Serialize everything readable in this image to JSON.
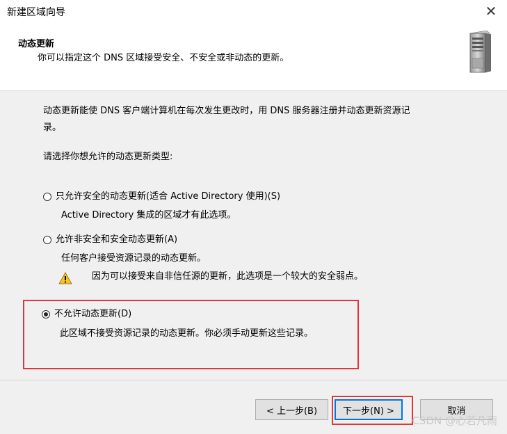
{
  "window": {
    "title": "新建区域向导",
    "close_glyph": "✕"
  },
  "header": {
    "title": "动态更新",
    "subtitle": "你可以指定这个 DNS 区域接受安全、不安全或非动态的更新。",
    "icon": "server-icon"
  },
  "body": {
    "intro_line1": "动态更新能使 DNS 客户端计算机在每次发生更改时，用 DNS 服务器注册并动态更新资源记",
    "intro_line2": "录。",
    "prompt": "请选择你想允许的动态更新类型:",
    "options": [
      {
        "label": "只允许安全的动态更新(适合 Active Directory 使用)(S)",
        "description": "Active Directory 集成的区域才有此选项。",
        "selected": false
      },
      {
        "label": "允许非安全和安全动态更新(A)",
        "description": "任何客户接受资源记录的动态更新。",
        "warning": "因为可以接受来自非信任源的更新，此选项是一个较大的安全弱点。",
        "selected": false
      },
      {
        "label": "不允许动态更新(D)",
        "description": "此区域不接受资源记录的动态更新。你必须手动更新这些记录。",
        "selected": true
      }
    ]
  },
  "footer": {
    "back_label": "< 上一步(B)",
    "next_label": "下一步(N) >",
    "cancel_label": "取消"
  },
  "watermark": "CSDN @心若凡雨",
  "colors": {
    "highlight": "#e0353b",
    "focus_border": "#0078d7",
    "background": "#f0f0f0"
  }
}
